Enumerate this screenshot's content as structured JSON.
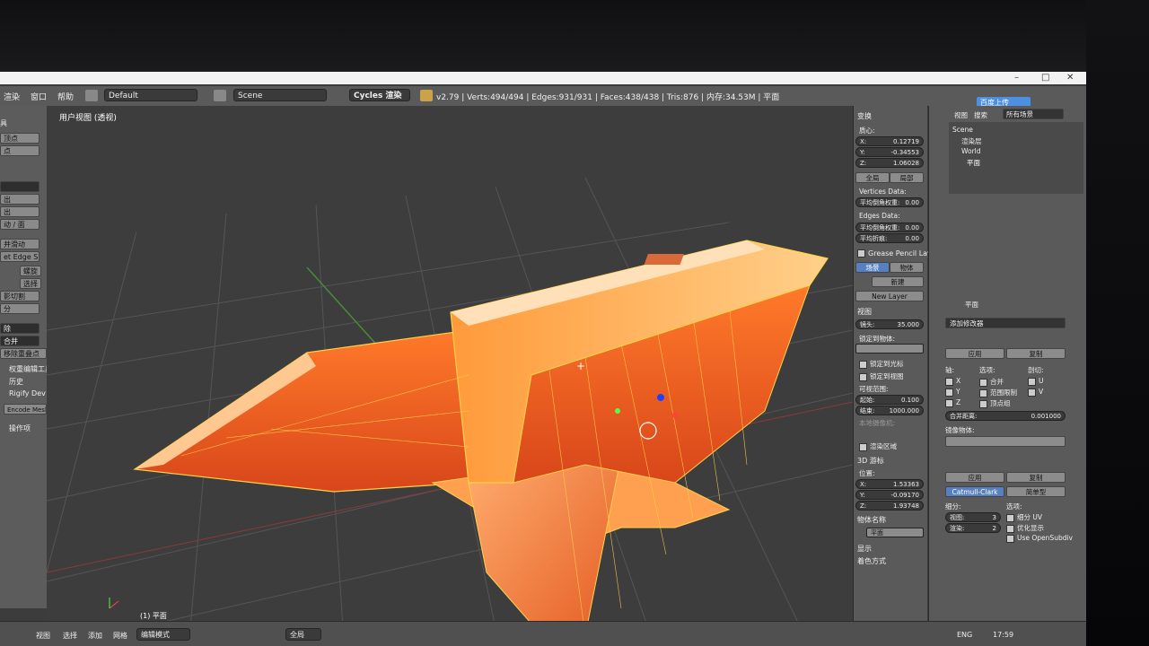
{
  "window": {
    "controls": [
      "–",
      "□",
      "✕"
    ],
    "upload_label": "百度上传"
  },
  "header": {
    "menus": [
      "渲染",
      "窗口",
      "帮助"
    ],
    "layout": "Default",
    "scene": "Scene",
    "engine": "Cycles 渲染",
    "stats": "v2.79 | Verts:494/494 | Edges:931/931 | Faces:438/438 | Tris:876 | 内存:34.53M | 平面"
  },
  "toolshelf": {
    "items": [
      "具",
      "顶点",
      "点",
      "",
      "出",
      "出",
      "动 / 面",
      "并滑动",
      "et Edge Slide",
      "螺旋",
      "选择",
      "影切割",
      "分",
      "除",
      "合并",
      "移除重叠点"
    ],
    "labels": [
      "权重编辑工具",
      "历史",
      "Rigify Dev Tools",
      "Encode Mesh Wi...",
      "操作项"
    ]
  },
  "viewport": {
    "title": "用户视图 (透视)",
    "object_label": "(1) 平面"
  },
  "npanel": {
    "section_transform": "变换",
    "median_label": "质心:",
    "x": {
      "k": "X:",
      "v": "0.12719"
    },
    "y": {
      "k": "Y:",
      "v": "-0.34553"
    },
    "z": {
      "k": "Z:",
      "v": "1.06028"
    },
    "global": "全局",
    "local": "局部",
    "vertices_data": "Vertices Data:",
    "mean_bevel_weight": {
      "k": "平均倒角权重:",
      "v": "0.00"
    },
    "edges_data": "Edges Data:",
    "edge_bevel_weight": {
      "k": "平均倒角权重:",
      "v": "0.00"
    },
    "edge_crease": {
      "k": "平均折痕:",
      "v": "0.00"
    },
    "grease_pencil": "Grease Pencil Layers",
    "scene_btn": "场景",
    "object_btn": "物体",
    "new_btn": "新建",
    "new_layer": "New Layer",
    "section_view": "视图",
    "lens": {
      "k": "镜头:",
      "v": "35.000"
    },
    "lock_to_object": "锁定到物体:",
    "lock_cursor": "锁定到光标",
    "lock_camera": "锁定到视图",
    "clip": "可视范围:",
    "clip_start": {
      "k": "起始:",
      "v": "0.100"
    },
    "clip_end": {
      "k": "结束:",
      "v": "1000.000"
    },
    "local_camera": "本地摄像机:",
    "render_border": "渲染区域",
    "section_cursor": "3D 游标",
    "location": "位置:",
    "cx": {
      "k": "X:",
      "v": "1.53363"
    },
    "cy": {
      "k": "Y:",
      "v": "-0.09170"
    },
    "cz": {
      "k": "Z:",
      "v": "1.93748"
    },
    "item_name": "物体名称",
    "item_value": "平面",
    "display": "显示",
    "shading": "着色方式"
  },
  "rpanel": {
    "tabs": [
      "视图",
      "搜索",
      "所有场景"
    ],
    "outliner": [
      "Scene",
      "渲染层",
      "World",
      "平面"
    ],
    "object_name": "平面",
    "add_modifier": "添加修改器",
    "apply": "应用",
    "copy": "复制",
    "axis": "轴:",
    "options": "选项:",
    "bisect": "剖切:",
    "ax": [
      "X",
      "Y",
      "Z"
    ],
    "merge": "合并",
    "clipping": "范围限制",
    "vertex_groups": "顶点组",
    "bu": [
      "U",
      "V"
    ],
    "merge_limit": {
      "k": "合并距离:",
      "v": "0.001000"
    },
    "mirror_object": "镜像物体:",
    "apply2": "应用",
    "copy2": "复制",
    "catmull": "Catmull-Clark",
    "simple": "简单型",
    "subdivisions": "细分:",
    "options2": "选项:",
    "view_levels": {
      "k": "视图:",
      "v": "3"
    },
    "render_levels": {
      "k": "渲染:",
      "v": "2"
    },
    "subdiv_uv": "细分 UV",
    "optimal": "优化显示",
    "opensubdiv": "Use OpenSubdiv"
  },
  "bottom": {
    "items": [
      "视图",
      "选择",
      "添加",
      "网格"
    ],
    "mode": "编辑模式",
    "pivot": "全局",
    "lang": "ENG",
    "time": "17:59"
  },
  "colors": {
    "accent": "#5680c2",
    "anvil_orange": "#ff8a1a",
    "wire": "#ffd24a"
  }
}
